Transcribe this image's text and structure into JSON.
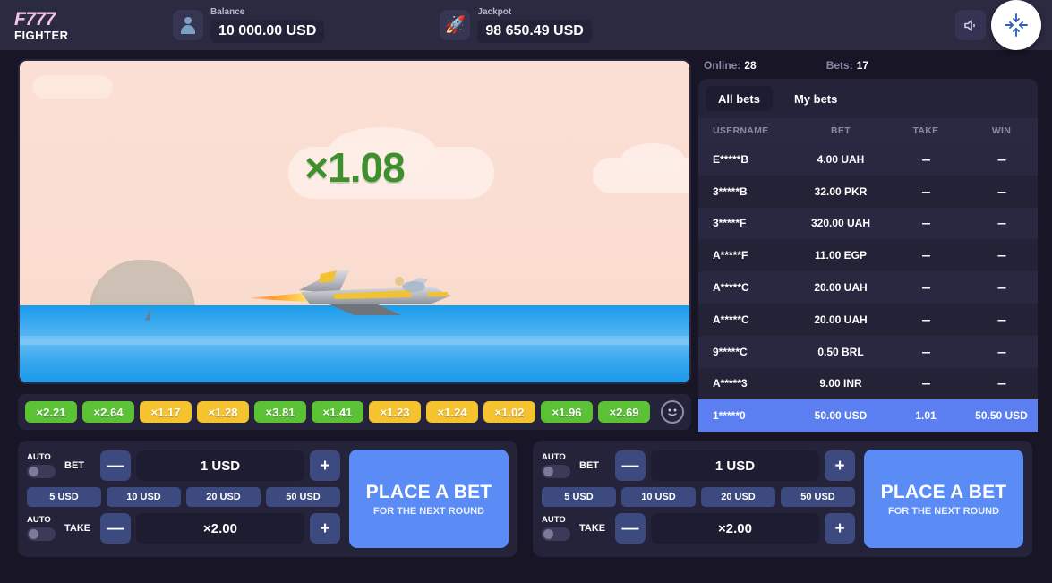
{
  "brand": {
    "line1": "F777",
    "line2": "FIGHTER"
  },
  "topbar": {
    "balance": {
      "label": "Balance",
      "value": "10 000.00 USD",
      "icon": "user-avatar-icon"
    },
    "jackpot": {
      "label": "Jackpot",
      "value": "98 650.49 USD",
      "icon": "rocket-icon"
    },
    "sound_icon": "speaker-icon",
    "fullscreen_icon": "exit-fullscreen-icon"
  },
  "game": {
    "multiplier": "×1.08",
    "multiplier_color": "#3f8f2f",
    "sky_color": "#fadfd3",
    "sea_color": "#2ba2ec",
    "plane": "fighter-jet"
  },
  "history": {
    "chips": [
      {
        "label": "×2.21",
        "tone": "green"
      },
      {
        "label": "×2.64",
        "tone": "green"
      },
      {
        "label": "×1.17",
        "tone": "yellow"
      },
      {
        "label": "×1.28",
        "tone": "yellow"
      },
      {
        "label": "×3.81",
        "tone": "green"
      },
      {
        "label": "×1.41",
        "tone": "green"
      },
      {
        "label": "×1.23",
        "tone": "yellow"
      },
      {
        "label": "×1.24",
        "tone": "yellow"
      },
      {
        "label": "×1.02",
        "tone": "yellow"
      },
      {
        "label": "×1.96",
        "tone": "green"
      },
      {
        "label": "×2.69",
        "tone": "green"
      }
    ],
    "smiley_icon": "smiley-face-icon"
  },
  "panel": {
    "online_label": "Online:",
    "online_value": "28",
    "bets_label": "Bets:",
    "bets_value": "17",
    "tabs": [
      {
        "label": "All bets",
        "active": true
      },
      {
        "label": "My bets",
        "active": false
      }
    ],
    "columns": [
      "USERNAME",
      "BET",
      "TAKE",
      "WIN"
    ],
    "rows": [
      {
        "username": "E*****B",
        "bet": "4.00 UAH",
        "take": "---",
        "win": "---",
        "highlight": false
      },
      {
        "username": "3*****B",
        "bet": "32.00 PKR",
        "take": "---",
        "win": "---",
        "highlight": false
      },
      {
        "username": "3*****F",
        "bet": "320.00 UAH",
        "take": "---",
        "win": "---",
        "highlight": false
      },
      {
        "username": "A*****F",
        "bet": "11.00 EGP",
        "take": "---",
        "win": "---",
        "highlight": false
      },
      {
        "username": "A*****C",
        "bet": "20.00 UAH",
        "take": "---",
        "win": "---",
        "highlight": false
      },
      {
        "username": "A*****C",
        "bet": "20.00 UAH",
        "take": "---",
        "win": "---",
        "highlight": false
      },
      {
        "username": "9*****C",
        "bet": "0.50 BRL",
        "take": "---",
        "win": "---",
        "highlight": false
      },
      {
        "username": "A*****3",
        "bet": "9.00 INR",
        "take": "---",
        "win": "---",
        "highlight": false
      },
      {
        "username": "1*****0",
        "bet": "50.00 USD",
        "take": "1.01",
        "win": "50.50 USD",
        "highlight": true
      }
    ]
  },
  "bet_panels": [
    {
      "auto_label": "AUTO",
      "bet_label": "BET",
      "take_label": "TAKE",
      "bet_value": "1 USD",
      "take_value": "×2.00",
      "minus": "—",
      "plus": "+",
      "quick": [
        "5 USD",
        "10 USD",
        "20 USD",
        "50 USD"
      ],
      "place_main": "PLACE A BET",
      "place_sub": "FOR THE NEXT ROUND"
    },
    {
      "auto_label": "AUTO",
      "bet_label": "BET",
      "take_label": "TAKE",
      "bet_value": "1 USD",
      "take_value": "×2.00",
      "minus": "—",
      "plus": "+",
      "quick": [
        "5 USD",
        "10 USD",
        "20 USD",
        "50 USD"
      ],
      "place_main": "PLACE A BET",
      "place_sub": "FOR THE NEXT ROUND"
    }
  ]
}
